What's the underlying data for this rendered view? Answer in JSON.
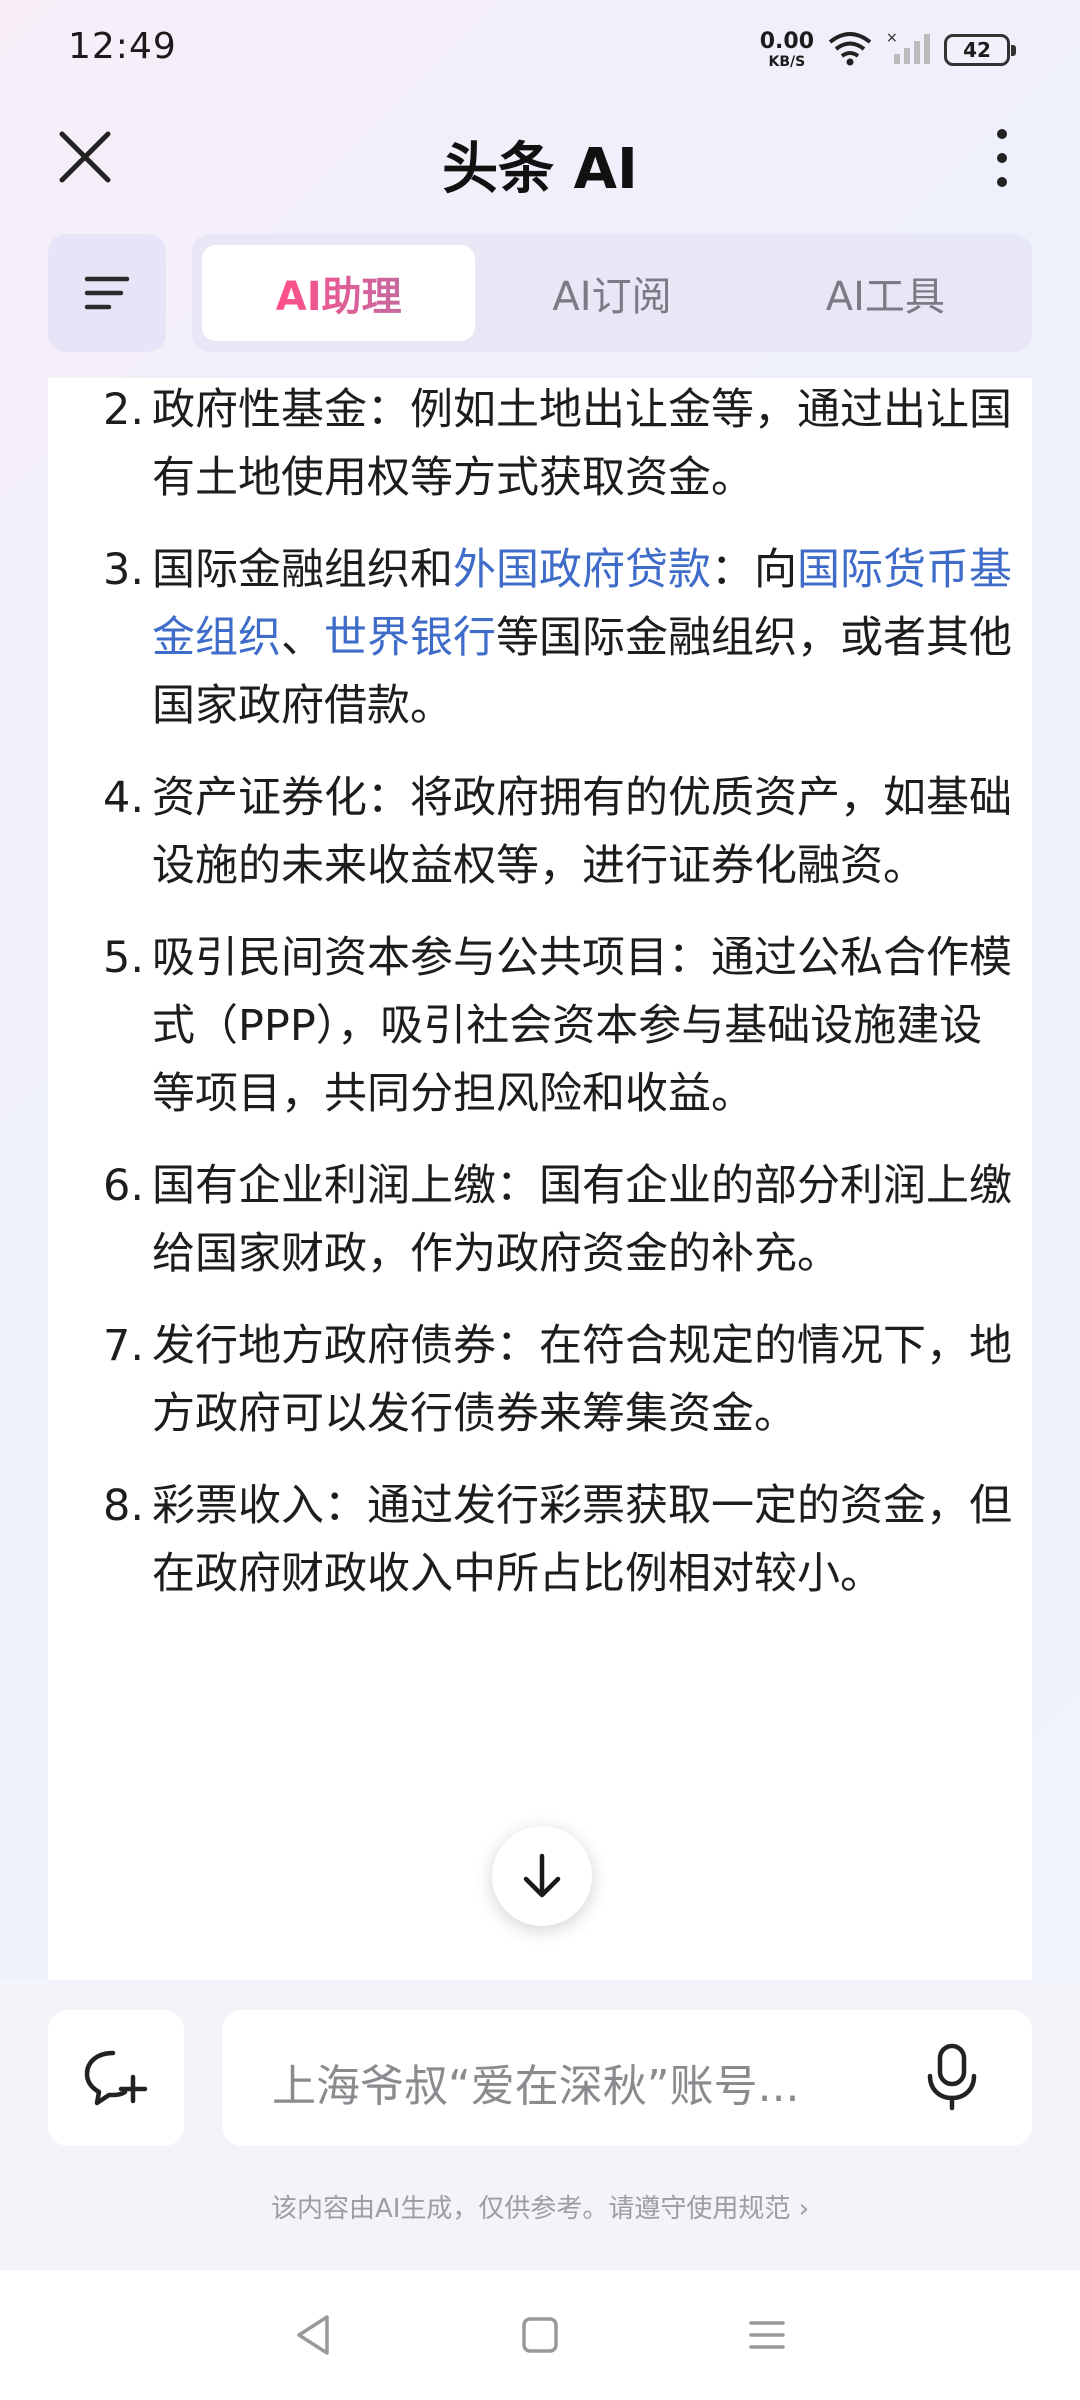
{
  "status_bar": {
    "time": "12:49",
    "net_speed_value": "0.00",
    "net_speed_unit": "KB/S",
    "battery": "42"
  },
  "header": {
    "title": "头条 AI"
  },
  "tabs": [
    {
      "label": "AI助理",
      "active": true
    },
    {
      "label": "AI订阅",
      "active": false
    },
    {
      "label": "AI工具",
      "active": false
    }
  ],
  "content": {
    "items": [
      {
        "num": "2.",
        "parts": [
          {
            "text": "政府性基金：例如土地出让金等，通过出让国有土地使用权等方式获取资金。"
          }
        ]
      },
      {
        "num": "3.",
        "parts": [
          {
            "text": "国际金融组织和"
          },
          {
            "text": "外国政府贷款",
            "link": true
          },
          {
            "text": "：向"
          },
          {
            "text": "国际货币基金组织",
            "link": true
          },
          {
            "text": "、"
          },
          {
            "text": "世界银行",
            "link": true
          },
          {
            "text": "等国际金融组织，或者其他国家政府借款。"
          }
        ]
      },
      {
        "num": "4.",
        "parts": [
          {
            "text": "资产证券化：将政府拥有的优质资产，如基础设施的未来收益权等，进行证券化融资。"
          }
        ]
      },
      {
        "num": "5.",
        "parts": [
          {
            "text": "吸引民间资本参与公共项目：通过公私合作模式（PPP），吸引社会资本参与基础设施建设等项目，共同分担风险和收益。"
          }
        ]
      },
      {
        "num": "6.",
        "parts": [
          {
            "text": "国有企业利润上缴：国有企业的部分利润上缴给国家财政，作为政府资金的补充。"
          }
        ]
      },
      {
        "num": "7.",
        "parts": [
          {
            "text": "发行地方政府债券：在符合规定的情况下，地方政府可以发行债券来筹集资金。"
          }
        ]
      },
      {
        "num": "8.",
        "parts": [
          {
            "text": "彩票收入：通过发行彩票获取一定的资金，但在政府财政收入中所占比例相对较小。"
          }
        ]
      }
    ]
  },
  "input": {
    "placeholder": "上海爷叔“爱在深秋”账号..."
  },
  "disclaimer": "该内容由AI生成，仅供参考。请遵守使用规范 ›",
  "colors": {
    "link": "#3f6cc9",
    "accent_gradient_start": "#ff4f8a"
  }
}
